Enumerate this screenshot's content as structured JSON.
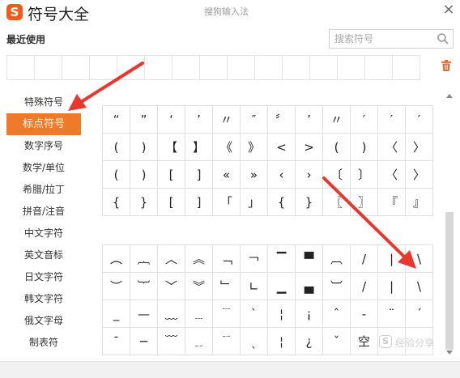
{
  "window": {
    "logo_letter": "S",
    "title": "符号大全",
    "subtitle": "搜狗输入法",
    "close_glyph": "×"
  },
  "recent": {
    "label": "最近使用",
    "search_placeholder": "搜索符号"
  },
  "sidebar": {
    "items": [
      {
        "label": "特殊符号",
        "active": false
      },
      {
        "label": "标点符号",
        "active": true
      },
      {
        "label": "数字序号",
        "active": false
      },
      {
        "label": "数学/单位",
        "active": false
      },
      {
        "label": "希腊/拉丁",
        "active": false
      },
      {
        "label": "拼音/注音",
        "active": false
      },
      {
        "label": "中文字符",
        "active": false
      },
      {
        "label": "英文音标",
        "active": false
      },
      {
        "label": "日文字符",
        "active": false
      },
      {
        "label": "韩文字符",
        "active": false
      },
      {
        "label": "俄文字母",
        "active": false
      },
      {
        "label": "制表符",
        "active": false
      }
    ]
  },
  "symbols_top": [
    "“",
    "”",
    "‘",
    "’",
    "〃",
    "″",
    "〞",
    "’",
    "〃",
    "′",
    "′",
    "′",
    "(",
    ")",
    "【",
    "】",
    "《",
    "》",
    "<",
    ">",
    "(",
    ")",
    "〈",
    "〉",
    "(",
    ")",
    "[",
    "]",
    "«",
    "»",
    "‹",
    "›",
    "〔",
    "〕",
    "〈",
    "〉",
    "{",
    "}",
    "[",
    "]",
    "「",
    "」",
    "{",
    "}",
    "〖",
    "〗",
    "『",
    "』"
  ],
  "symbols_bottom": [
    "︵",
    "︷",
    "︿",
    "︽",
    "﹁",
    "￢",
    "▔",
    "▀",
    "︹",
    "/",
    "|",
    "\\",
    "︶",
    "︸",
    "﹀",
    "︾",
    "﹂",
    "∟",
    "▁",
    "▄",
    "︺",
    "/",
    "|",
    "\\",
    "_",
    "—",
    "﹏",
    "﹍",
    "﹉",
    "ˋ",
    "¦",
    "¡",
    "ˆ",
    "-",
    "¨",
    "ˊ",
    "¯",
    "─",
    "﹋",
    "﹎",
    "﹊",
    "ˎ",
    "¦",
    "¿",
    "ˇ",
    "空",
    "",
    ""
  ],
  "watermark": {
    "badge": "S",
    "text": "经验分享"
  },
  "colors": {
    "accent": "#f07a2c",
    "logo": "#f05a1a",
    "arrow": "#e8372f",
    "trash": "#e8692c"
  }
}
